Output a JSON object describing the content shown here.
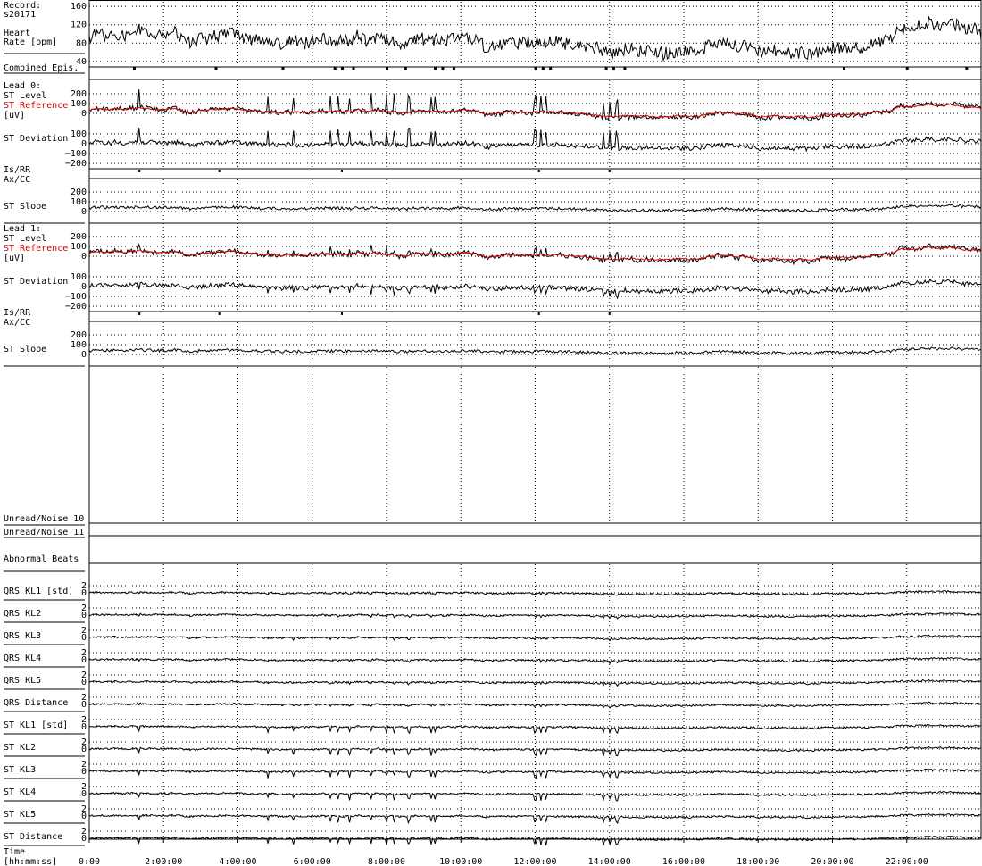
{
  "chart_data": {
    "type": "line",
    "record_label": "Record:",
    "record_id": "s20171",
    "heart_rate": {
      "label_line1": "Heart",
      "label_line2": "Rate [bpm]",
      "ticks": [
        160,
        120,
        80,
        40
      ],
      "range": [
        30,
        170
      ],
      "mean": 90
    },
    "combined_episodes": {
      "label": "Combined Epis.",
      "marks_hours": [
        1.2,
        3.4,
        5.2,
        6.6,
        6.8,
        7.1,
        8.0,
        8.5,
        9.3,
        9.5,
        9.8,
        12.0,
        12.2,
        12.4,
        13.9,
        14.1,
        14.4,
        20.3,
        22.0,
        23.6
      ]
    },
    "leads": [
      {
        "label_title": "Lead 0:",
        "label_level": "ST Level",
        "label_reference": "ST Reference",
        "label_unit": "[uV]",
        "label_deviation": "ST Deviation",
        "level_ticks": [
          "200",
          "100",
          "0"
        ],
        "deviation_ticks": [
          "100",
          "0",
          "−100",
          "−200"
        ],
        "isrr_label_line1": "Is/RR",
        "isrr_label_line2": "Ax/CC",
        "slope_label": "ST Slope",
        "slope_ticks": [
          "200",
          "100",
          "0"
        ]
      },
      {
        "label_title": "Lead 1:",
        "label_level": "ST Level",
        "label_reference": "ST Reference",
        "label_unit": "[uV]",
        "label_deviation": "ST Deviation",
        "level_ticks": [
          "200",
          "100",
          "0"
        ],
        "deviation_ticks": [
          "100",
          "0",
          "−100",
          "−200"
        ],
        "isrr_label_line1": "Is/RR",
        "isrr_label_line2": "Ax/CC",
        "slope_label": "ST Slope",
        "slope_ticks": [
          "200",
          "100",
          "0"
        ]
      }
    ],
    "noise_rows": [
      "Unread/Noise 10",
      "Unread/Noise 11"
    ],
    "abnormal_beats_label": "Abnormal Beats",
    "kl_rows": [
      {
        "label": "QRS KL1 [std]",
        "ticks": [
          "2",
          "0"
        ]
      },
      {
        "label": "QRS KL2",
        "ticks": [
          "2",
          "0"
        ]
      },
      {
        "label": "QRS KL3",
        "ticks": [
          "2",
          "0"
        ]
      },
      {
        "label": "QRS KL4",
        "ticks": [
          "2",
          "0"
        ]
      },
      {
        "label": "QRS KL5",
        "ticks": [
          "2",
          "0"
        ]
      },
      {
        "label": "QRS Distance",
        "ticks": [
          "2",
          "0"
        ]
      },
      {
        "label": "ST KL1 [std]",
        "ticks": [
          "2",
          "0"
        ]
      },
      {
        "label": "ST KL2",
        "ticks": [
          "2",
          "0"
        ]
      },
      {
        "label": "ST KL3",
        "ticks": [
          "2",
          "0"
        ]
      },
      {
        "label": "ST KL4",
        "ticks": [
          "2",
          "0"
        ]
      },
      {
        "label": "ST KL5",
        "ticks": [
          "2",
          "0"
        ]
      },
      {
        "label": "ST Distance",
        "ticks": [
          "2",
          "0"
        ]
      }
    ],
    "x_axis": {
      "label_line1": "Time",
      "label_line2": "[hh:mm:ss]",
      "tick_labels": [
        "0:00",
        "2:00:00",
        "4:00:00",
        "6:00:00",
        "8:00:00",
        "10:00:00",
        "12:00:00",
        "14:00:00",
        "16:00:00",
        "18:00:00",
        "20:00:00",
        "22:00:00"
      ],
      "range_hours": [
        0,
        24
      ]
    },
    "spike_times_hours": [
      1.35,
      4.8,
      5.5,
      6.5,
      6.7,
      7.0,
      7.6,
      8.0,
      8.2,
      8.6,
      9.2,
      9.3,
      12.0,
      12.15,
      12.3,
      13.85,
      14.0,
      14.2
    ],
    "colors": {
      "trace": "#000000",
      "reference": "#e00000",
      "grid": "#000000"
    }
  }
}
